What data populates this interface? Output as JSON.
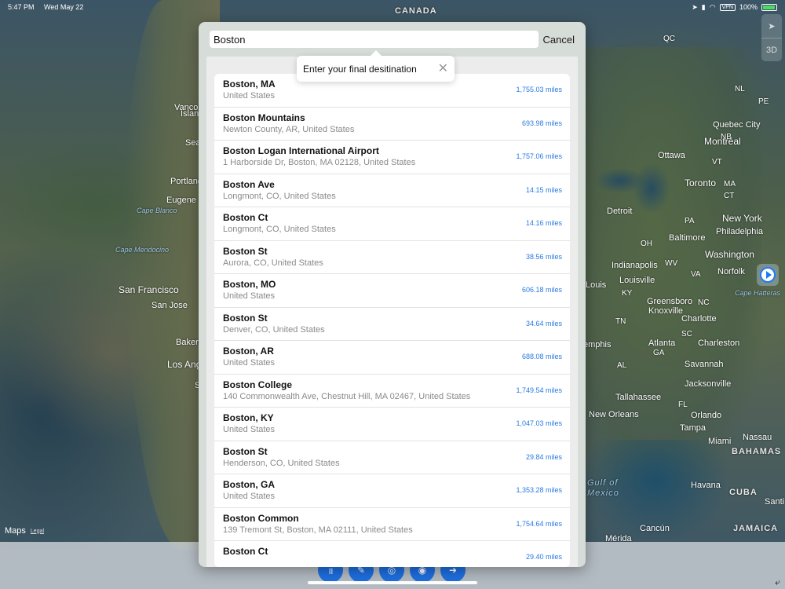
{
  "status_bar": {
    "time": "5:47 PM",
    "date": "Wed May 22",
    "vpn": "VPN",
    "battery": "100%"
  },
  "map": {
    "controls": {
      "location_icon": "location-arrow-icon",
      "mode_3d": "3D"
    },
    "labels": [
      {
        "text": "CANADA",
        "kind": "country"
      },
      {
        "text": "QC",
        "kind": "region"
      },
      {
        "text": "NL",
        "kind": "region"
      },
      {
        "text": "PE",
        "kind": "region"
      },
      {
        "text": "Quebec City",
        "kind": "city"
      },
      {
        "text": "NB",
        "kind": "region"
      },
      {
        "text": "Montréal",
        "kind": "big"
      },
      {
        "text": "Ottawa",
        "kind": "city"
      },
      {
        "text": "VT",
        "kind": "region"
      },
      {
        "text": "Toronto",
        "kind": "big"
      },
      {
        "text": "MA",
        "kind": "region"
      },
      {
        "text": "CT",
        "kind": "region"
      },
      {
        "text": "Detroit",
        "kind": "city"
      },
      {
        "text": "PA",
        "kind": "region"
      },
      {
        "text": "New York",
        "kind": "big"
      },
      {
        "text": "Philadelphia",
        "kind": "city"
      },
      {
        "text": "Baltimore",
        "kind": "city"
      },
      {
        "text": "OH",
        "kind": "region"
      },
      {
        "text": "Washington",
        "kind": "big"
      },
      {
        "text": "Indianapolis",
        "kind": "city"
      },
      {
        "text": "WV",
        "kind": "region"
      },
      {
        "text": "VA",
        "kind": "region"
      },
      {
        "text": "Norfolk",
        "kind": "city"
      },
      {
        "text": "Louis",
        "kind": "city"
      },
      {
        "text": "Louisville",
        "kind": "city"
      },
      {
        "text": "KY",
        "kind": "region"
      },
      {
        "text": "Cape Hatteras",
        "kind": "water"
      },
      {
        "text": "Greensboro",
        "kind": "city"
      },
      {
        "text": "NC",
        "kind": "region"
      },
      {
        "text": "Knoxville",
        "kind": "city"
      },
      {
        "text": "TN",
        "kind": "region"
      },
      {
        "text": "Charlotte",
        "kind": "city"
      },
      {
        "text": "SC",
        "kind": "region"
      },
      {
        "text": "emphis",
        "kind": "city"
      },
      {
        "text": "Atlanta",
        "kind": "city"
      },
      {
        "text": "GA",
        "kind": "region"
      },
      {
        "text": "Charleston",
        "kind": "city"
      },
      {
        "text": "AL",
        "kind": "region"
      },
      {
        "text": "Savannah",
        "kind": "city"
      },
      {
        "text": "Jacksonville",
        "kind": "city"
      },
      {
        "text": "Tallahassee",
        "kind": "city"
      },
      {
        "text": "FL",
        "kind": "region"
      },
      {
        "text": "New Orleans",
        "kind": "city"
      },
      {
        "text": "Orlando",
        "kind": "city"
      },
      {
        "text": "Tampa",
        "kind": "city"
      },
      {
        "text": "Miami",
        "kind": "city"
      },
      {
        "text": "Nassau",
        "kind": "city"
      },
      {
        "text": "BAHAMAS",
        "kind": "country"
      },
      {
        "text": "Gulf of",
        "kind": "gulf"
      },
      {
        "text": "Mexico",
        "kind": "gulf"
      },
      {
        "text": "Havana",
        "kind": "city"
      },
      {
        "text": "CUBA",
        "kind": "country"
      },
      {
        "text": "Santi",
        "kind": "city"
      },
      {
        "text": "Cancún",
        "kind": "city"
      },
      {
        "text": "Mérida",
        "kind": "city"
      },
      {
        "text": "JAMAICA",
        "kind": "country"
      },
      {
        "text": "Vancou",
        "kind": "city"
      },
      {
        "text": "Island",
        "kind": "city"
      },
      {
        "text": "Sea",
        "kind": "city"
      },
      {
        "text": "Portland",
        "kind": "city"
      },
      {
        "text": "Eugene",
        "kind": "city"
      },
      {
        "text": "Cape Blanco",
        "kind": "water"
      },
      {
        "text": "Cape Mendocino",
        "kind": "water"
      },
      {
        "text": "San Francisco",
        "kind": "big"
      },
      {
        "text": "San Jose",
        "kind": "city"
      },
      {
        "text": "Bakers",
        "kind": "city"
      },
      {
        "text": "Los Ang",
        "kind": "big"
      },
      {
        "text": "S",
        "kind": "city"
      }
    ],
    "brand": "Maps",
    "legal": "Legal"
  },
  "search": {
    "query": "Boston",
    "placeholder": "Search",
    "cancel_label": "Cancel"
  },
  "tooltip": {
    "text": "Enter your final desitination",
    "close_glyph": "✕"
  },
  "results": [
    {
      "title": "Boston, MA",
      "subtitle": "United States",
      "distance": "1,755.03 miles"
    },
    {
      "title": "Boston Mountains",
      "subtitle": "Newton County, AR, United States",
      "distance": "693.98 miles"
    },
    {
      "title": "Boston Logan International Airport",
      "subtitle": "1 Harborside Dr, Boston, MA 02128, United States",
      "distance": "1,757.06 miles"
    },
    {
      "title": "Boston Ave",
      "subtitle": "Longmont, CO, United States",
      "distance": "14.15 miles"
    },
    {
      "title": "Boston Ct",
      "subtitle": "Longmont, CO, United States",
      "distance": "14.16 miles"
    },
    {
      "title": "Boston St",
      "subtitle": "Aurora, CO, United States",
      "distance": "38.56 miles"
    },
    {
      "title": "Boston, MO",
      "subtitle": "United States",
      "distance": "606.18 miles"
    },
    {
      "title": "Boston St",
      "subtitle": "Denver, CO, United States",
      "distance": "34.64 miles"
    },
    {
      "title": "Boston, AR",
      "subtitle": "United States",
      "distance": "688.08 miles"
    },
    {
      "title": "Boston College",
      "subtitle": "140 Commonwealth Ave, Chestnut Hill, MA 02467, United States",
      "distance": "1,749.54 miles"
    },
    {
      "title": "Boston, KY",
      "subtitle": "United States",
      "distance": "1,047.03 miles"
    },
    {
      "title": "Boston St",
      "subtitle": "Henderson, CO, United States",
      "distance": "29.84 miles"
    },
    {
      "title": "Boston, GA",
      "subtitle": "United States",
      "distance": "1,353.28 miles"
    },
    {
      "title": "Boston Common",
      "subtitle": "139 Tremont St, Boston, MA 02111, United States",
      "distance": "1,754.64 miles"
    },
    {
      "title": "Boston Ct",
      "subtitle": "",
      "distance": "29.40 miles"
    }
  ],
  "colors": {
    "accent": "#2a7ae2",
    "dock_button": "#1e6fe0"
  }
}
